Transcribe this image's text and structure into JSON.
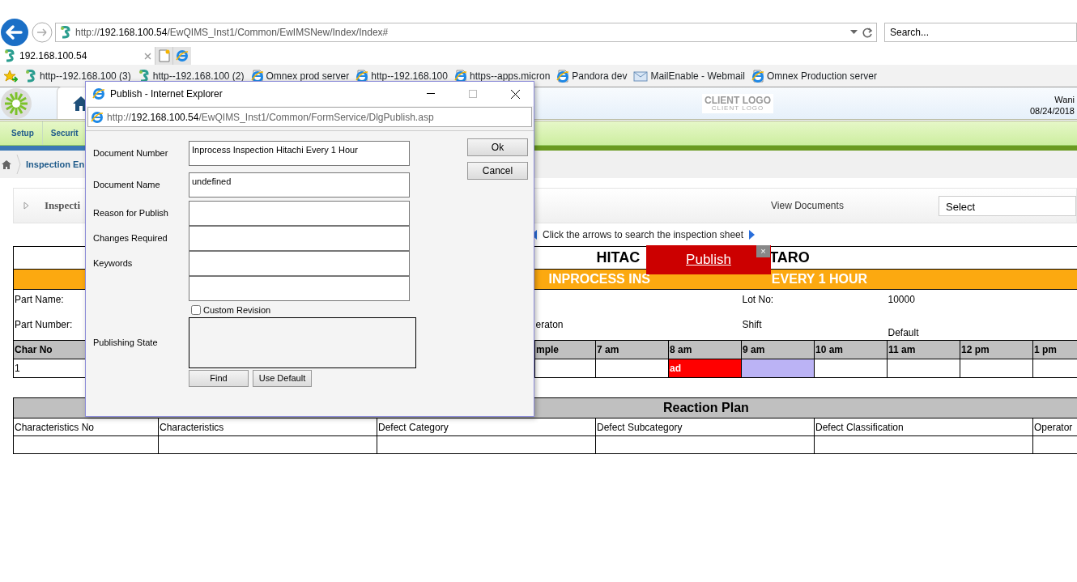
{
  "browser": {
    "address": "http://192.168.100.54/EwQIMS_Inst1/Common/EwIMSNew/Index/Index#",
    "search": {
      "placeholder": "Search..."
    },
    "tabs": [
      {
        "label": "192.168.100.54",
        "selected": true
      }
    ],
    "favorites": [
      {
        "label": "http--192.168.100 (3)",
        "kind": "site"
      },
      {
        "label": "http--192.168.100 (2)",
        "kind": "site"
      },
      {
        "label": "Omnex prod server",
        "kind": "ie"
      },
      {
        "label": "http--192.168.100",
        "kind": "ie"
      },
      {
        "label": "https--apps.micron",
        "kind": "ie"
      },
      {
        "label": "Pandora dev",
        "kind": "ie"
      },
      {
        "label": "MailEnable - Webmail",
        "kind": "mail"
      },
      {
        "label": "Omnex Production server",
        "kind": "ie"
      }
    ]
  },
  "app": {
    "logo_text": "CLIENT LOGO",
    "logo_subtext": "CLIENT LOGO",
    "user": "Wani",
    "date": "08/24/2018",
    "menu": [
      {
        "label": "Setup",
        "selected": false
      },
      {
        "label": "Securit",
        "selected": false
      }
    ],
    "breadcrumb": "Inspection En",
    "panel_title": "Inspecti",
    "view_documents": "View Documents",
    "select": {
      "value": "Select"
    },
    "hint": "Click the arrows to search the inspection sheet"
  },
  "sheet": {
    "title_parts": [
      "HITAC",
      "TARO"
    ],
    "subtitle_parts": [
      "INPROCESS INS",
      "EVERY 1 HOUR"
    ],
    "part_name_label": "Part Name:",
    "part_number_label": "Part Number:",
    "operator_label": "eraton",
    "lot_no_label": "Lot No:",
    "lot_no": "10000",
    "shift_label": "Shift",
    "shift": "Default",
    "columns": [
      "Char No",
      "mple",
      "7 am",
      "8 am",
      "9 am",
      "10 am",
      "11 am",
      "12 pm",
      "1 pm"
    ],
    "rows": [
      {
        "cells": [
          {
            "kind": "plain",
            "text": "1"
          },
          {
            "kind": "plain"
          },
          {
            "kind": "plain"
          },
          {
            "kind": "failed",
            "text": "ad",
            "color": "#ff0000"
          },
          {
            "kind": "current",
            "color": "#bbb3f5"
          },
          {
            "kind": "plain"
          },
          {
            "kind": "plain"
          },
          {
            "kind": "plain"
          },
          {
            "kind": "plain"
          }
        ]
      }
    ]
  },
  "reaction_plan": {
    "title": "Reaction Plan",
    "columns": [
      "Characteristics No",
      "Characteristics",
      "Defect Category",
      "Defect Subcategory",
      "Defect Classification",
      "Operator"
    ]
  },
  "popup": {
    "label": "Publish",
    "close": "×"
  },
  "dialog": {
    "title": "Publish - Internet Explorer",
    "address": "http://192.168.100.54/EwQIMS_Inst1/Common/FormService/DlgPublish.asp",
    "fields": [
      {
        "label": "Document Number",
        "value": "Inprocess Inspection Hitachi Every 1 Hour"
      },
      {
        "label": "Document Name",
        "value": "undefined"
      },
      {
        "label": "Reason for Publish"
      },
      {
        "label": "Changes Required"
      },
      {
        "label": "Keywords"
      }
    ],
    "unlabeled_field": true,
    "custom_revision": {
      "label": "Custom Revision",
      "checked": false
    },
    "publishing_state_label": "Publishing State",
    "state_buttons": [
      "Find",
      "Use Default"
    ],
    "buttons": [
      "Ok",
      "Cancel"
    ]
  }
}
